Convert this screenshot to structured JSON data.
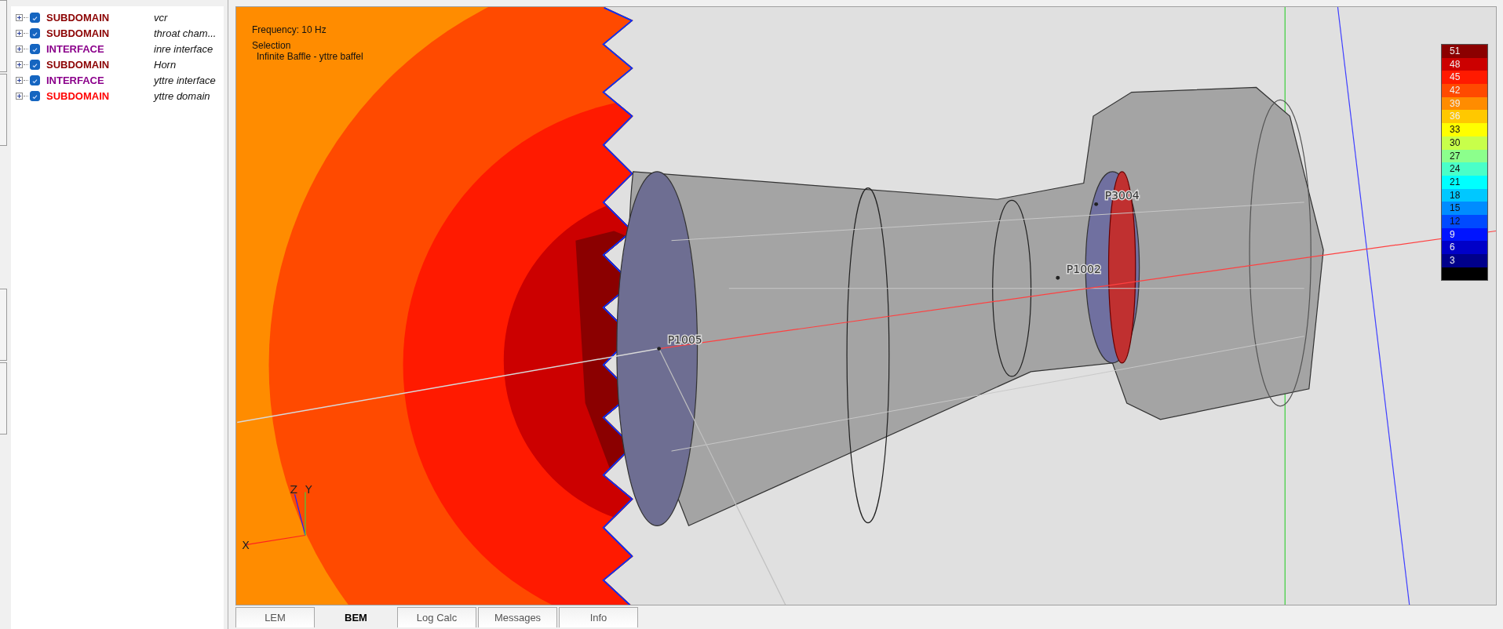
{
  "tree": [
    {
      "type": "SUBDOMAIN",
      "name": "vcr",
      "checked": true,
      "expanded": false,
      "color": "#8b0000"
    },
    {
      "type": "SUBDOMAIN",
      "name": "throat cham...",
      "checked": true,
      "expanded": false,
      "color": "#8b0000"
    },
    {
      "type": "INTERFACE",
      "name": "inre interface",
      "checked": true,
      "expanded": false,
      "color": "#8b008b"
    },
    {
      "type": "SUBDOMAIN",
      "name": "Horn",
      "checked": true,
      "expanded": false,
      "color": "#8b0000"
    },
    {
      "type": "INTERFACE",
      "name": "yttre interface",
      "checked": true,
      "expanded": false,
      "color": "#8b008b"
    },
    {
      "type": "SUBDOMAIN",
      "name": "yttre domain",
      "checked": true,
      "expanded": false,
      "color": "#ff0000"
    }
  ],
  "viewport": {
    "frequency": "Frequency: 10 Hz",
    "selection_title": "Selection",
    "selection": "Infinite Baffle - yttre baffel",
    "points": [
      "P1005",
      "P1002",
      "P3004"
    ],
    "axes": [
      "Z",
      "Y",
      "X"
    ],
    "legend": [
      {
        "label": "51",
        "color": "#8b0000"
      },
      {
        "label": "48",
        "color": "#cc0000"
      },
      {
        "label": "45",
        "color": "#ff1a00"
      },
      {
        "label": "42",
        "color": "#ff4a00"
      },
      {
        "label": "39",
        "color": "#ff8c00"
      },
      {
        "label": "36",
        "color": "#ffc800"
      },
      {
        "label": "33",
        "color": "#ffff00"
      },
      {
        "label": "30",
        "color": "#c8ff4a"
      },
      {
        "label": "27",
        "color": "#8cff8c"
      },
      {
        "label": "24",
        "color": "#4affc8"
      },
      {
        "label": "21",
        "color": "#00ffff"
      },
      {
        "label": "18",
        "color": "#00c8ff"
      },
      {
        "label": "15",
        "color": "#008cff"
      },
      {
        "label": "12",
        "color": "#004aff"
      },
      {
        "label": "9",
        "color": "#0014ff"
      },
      {
        "label": "6",
        "color": "#0000c8"
      },
      {
        "label": "3",
        "color": "#00008b"
      },
      {
        "color": "#000000"
      }
    ]
  },
  "tabs": [
    {
      "label": "LEM",
      "selected": false
    },
    {
      "label": "BEM",
      "selected": true
    },
    {
      "label": "Log Calc",
      "selected": false
    },
    {
      "label": "Messages",
      "selected": false
    },
    {
      "label": "Info",
      "selected": false
    }
  ]
}
